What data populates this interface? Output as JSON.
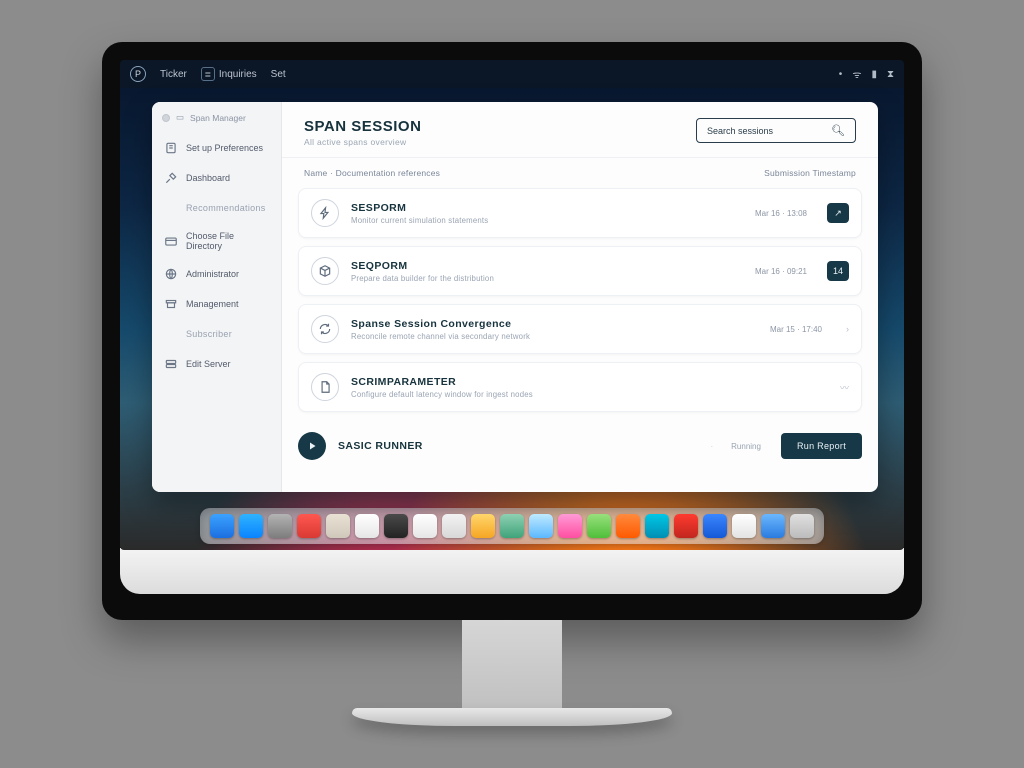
{
  "menubar": {
    "app_label": "Ticker",
    "item2": "Inquiries",
    "item3": "Set",
    "right1": "",
    "right2": "",
    "right3": ""
  },
  "window": {
    "titlebar_label": "Span Manager"
  },
  "sidebar": {
    "items": [
      {
        "label": "Set up Preferences"
      },
      {
        "label": "Dashboard"
      },
      {
        "label": "Recommendations"
      },
      {
        "label": "Choose File Directory"
      },
      {
        "label": "Administrator"
      },
      {
        "label": "Management"
      },
      {
        "label": "Subscriber"
      },
      {
        "label": "Edit Server"
      }
    ]
  },
  "header": {
    "title": "SPAN SESSION",
    "sub": "All active spans overview",
    "search_placeholder": "Search sessions"
  },
  "subheader": {
    "left": "Name · Documentation references",
    "right": "Submission Timestamp"
  },
  "list": [
    {
      "title": "SESPORM",
      "desc": "Monitor current simulation statements",
      "meta": "Mar 16 · 13:08",
      "badge": "↗"
    },
    {
      "title": "SEQPORM",
      "desc": "Prepare data builder for the distribution",
      "meta": "Mar 16 · 09:21",
      "badge": "14"
    },
    {
      "title": "Spanse Session Convergence",
      "desc": "Reconcile remote channel via secondary network",
      "meta": "Mar 15 · 17:40",
      "badge": ""
    },
    {
      "title": "SCRIMPARAMETER",
      "desc": "Configure default latency window for ingest nodes",
      "meta": "",
      "badge": ""
    }
  ],
  "footer": {
    "title": "SASIC RUNNER",
    "divider": "·",
    "status": "Running",
    "primary": "Run Report"
  },
  "colors": {
    "accent": "#173846"
  }
}
